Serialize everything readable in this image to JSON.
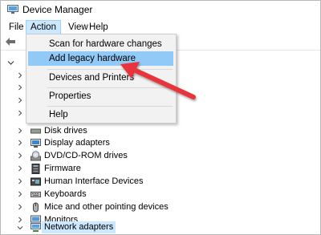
{
  "window": {
    "title": "Device Manager",
    "icon": "device-manager-icon"
  },
  "menubar": {
    "items": [
      "File",
      "Action",
      "View",
      "Help"
    ]
  },
  "action_menu": {
    "items": [
      {
        "label": "Scan for hardware changes",
        "highlighted": false
      },
      {
        "label": "Add legacy hardware",
        "highlighted": true
      },
      {
        "label": "Devices and Printers",
        "highlighted": false
      },
      {
        "label": "Properties",
        "highlighted": false
      },
      {
        "label": "Help",
        "highlighted": false
      }
    ]
  },
  "tree": {
    "items": [
      {
        "label": "Disk drives",
        "icon": "disk-drive-icon"
      },
      {
        "label": "Display adapters",
        "icon": "display-adapter-icon"
      },
      {
        "label": "DVD/CD-ROM drives",
        "icon": "dvd-drive-icon"
      },
      {
        "label": "Firmware",
        "icon": "firmware-icon"
      },
      {
        "label": "Human Interface Devices",
        "icon": "hid-icon"
      },
      {
        "label": "Keyboards",
        "icon": "keyboard-icon"
      },
      {
        "label": "Mice and other pointing devices",
        "icon": "mouse-icon"
      },
      {
        "label": "Monitors",
        "icon": "monitor-icon"
      },
      {
        "label": "Network adapters",
        "icon": "network-adapter-icon",
        "selected": true
      }
    ]
  },
  "colors": {
    "highlight": "#91c9f7",
    "selection": "#cce8ff",
    "arrow": "#e8363c"
  }
}
